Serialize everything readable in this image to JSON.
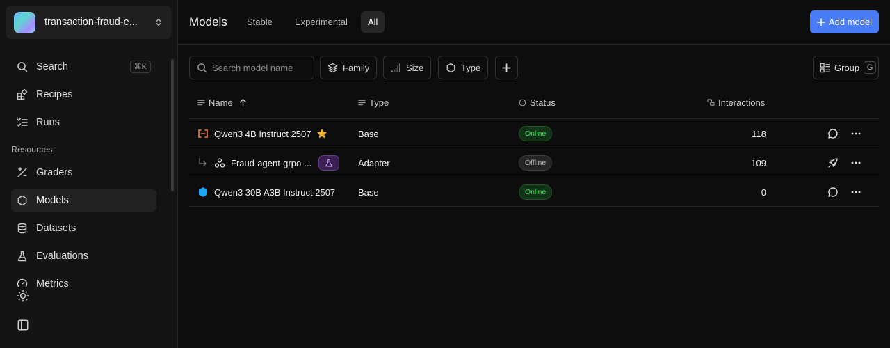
{
  "project": {
    "name": "transaction-fraud-e..."
  },
  "nav": {
    "search": {
      "label": "Search",
      "shortcut": "⌘K"
    },
    "recipes": "Recipes",
    "runs": "Runs",
    "resources_label": "Resources",
    "graders": "Graders",
    "models": "Models",
    "datasets": "Datasets",
    "evaluations": "Evaluations",
    "metrics": "Metrics"
  },
  "header": {
    "title": "Models",
    "tabs": [
      "Stable",
      "Experimental",
      "All"
    ],
    "active_tab": "All",
    "add_button": "Add model"
  },
  "toolbar": {
    "search_placeholder": "Search model name",
    "filters": [
      "Family",
      "Size",
      "Type"
    ],
    "group_label": "Group",
    "group_shortcut": "G"
  },
  "table": {
    "columns": {
      "name": "Name",
      "type": "Type",
      "status": "Status",
      "interactions": "Interactions"
    },
    "rows": [
      {
        "name": "Qwen3 4B Instruct 2507",
        "type": "Base",
        "status": "Online",
        "interactions": "118",
        "starred": true,
        "icon": "qwen-logo-icon"
      },
      {
        "name": "Fraud-agent-grpo-...",
        "type": "Adapter",
        "status": "Offline",
        "interactions": "109",
        "experimental": true,
        "icon": "adapter-icon"
      },
      {
        "name": "Qwen3 30B A3B Instruct 2507",
        "type": "Base",
        "status": "Online",
        "interactions": "0",
        "icon": "hexagon-model-icon"
      }
    ]
  },
  "colors": {
    "accent": "#4a7cf7",
    "online": "#4cd964",
    "star": "#f5b82e",
    "qwen_orange": "#f07a2a",
    "hex_blue": "#1ea7f0"
  }
}
